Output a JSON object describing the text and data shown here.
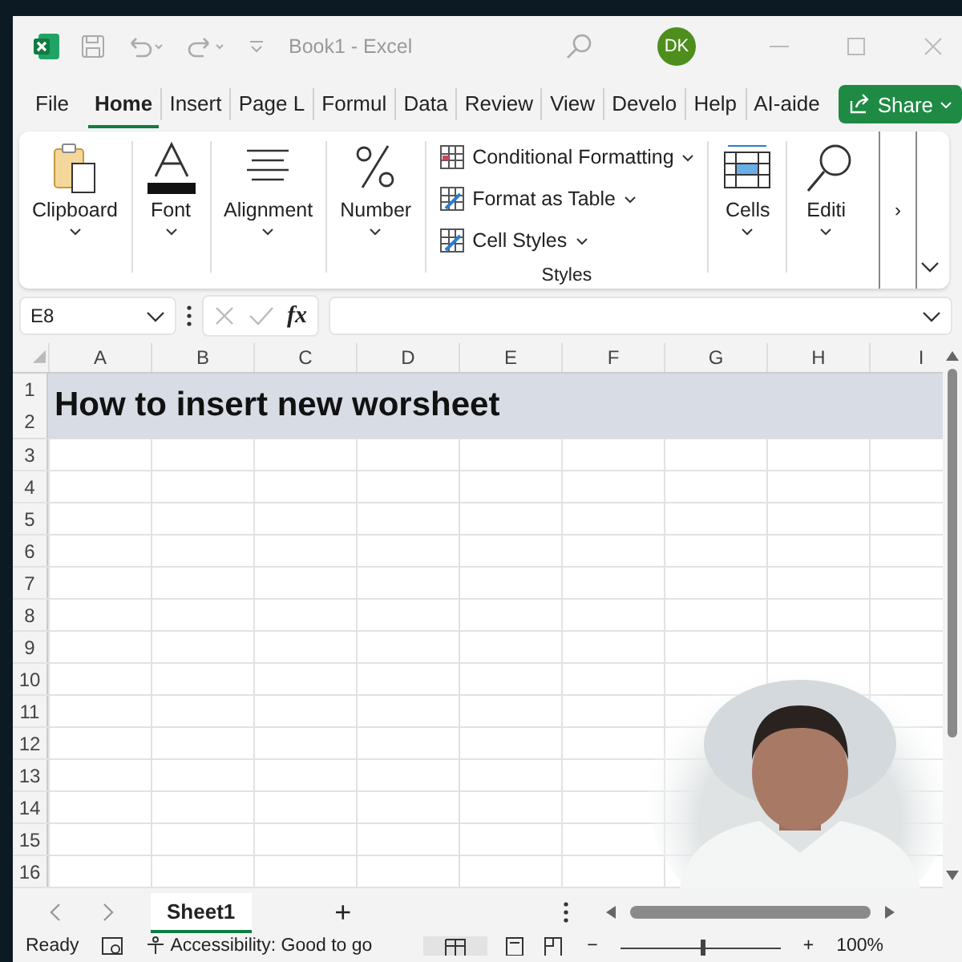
{
  "title_bar": {
    "title": "Book1  -  Excel",
    "user_initials": "DK"
  },
  "tabs": [
    {
      "label": "File",
      "selected": false
    },
    {
      "label": "Home",
      "selected": true
    },
    {
      "label": "Insert",
      "selected": false
    },
    {
      "label": "Page L",
      "selected": false
    },
    {
      "label": "Formul",
      "selected": false
    },
    {
      "label": "Data",
      "selected": false
    },
    {
      "label": "Review",
      "selected": false
    },
    {
      "label": "View",
      "selected": false
    },
    {
      "label": "Develo",
      "selected": false
    },
    {
      "label": "Help",
      "selected": false
    },
    {
      "label": "AI-aide",
      "selected": false
    }
  ],
  "share_button": {
    "label": "Share"
  },
  "ribbon": {
    "groups": [
      {
        "kind": "clipboard",
        "label": "Clipboard"
      },
      {
        "kind": "font",
        "label": "Font"
      },
      {
        "kind": "alignment",
        "label": "Alignment"
      },
      {
        "kind": "number",
        "label": "Number"
      },
      {
        "kind": "styles",
        "label": "Styles",
        "items": [
          "Conditional Formatting",
          "Format as Table",
          "Cell Styles"
        ]
      },
      {
        "kind": "cells",
        "label": "Cells"
      },
      {
        "kind": "editing",
        "label": "Editi"
      }
    ],
    "scroll_label": "›"
  },
  "formula_bar": {
    "name_box": "E8",
    "fx": "fx"
  },
  "sheet": {
    "columns": [
      "A",
      "B",
      "C",
      "D",
      "E",
      "F",
      "G",
      "H",
      "I"
    ],
    "rows": [
      "1",
      "2",
      "3",
      "4",
      "5",
      "6",
      "7",
      "8",
      "9",
      "10",
      "11",
      "12",
      "13",
      "14",
      "15",
      "16"
    ],
    "title_cell": "How to insert new worsheet"
  },
  "sheet_tabs": [
    {
      "label": "Sheet1",
      "selected": true
    }
  ],
  "add_sheet": "+",
  "status_bar": {
    "ready": "Ready",
    "accessibility": "Accessibility: Good to go",
    "zoom_minus": "−",
    "zoom_plus": "+",
    "zoom": "100%",
    "level": 0.5
  }
}
